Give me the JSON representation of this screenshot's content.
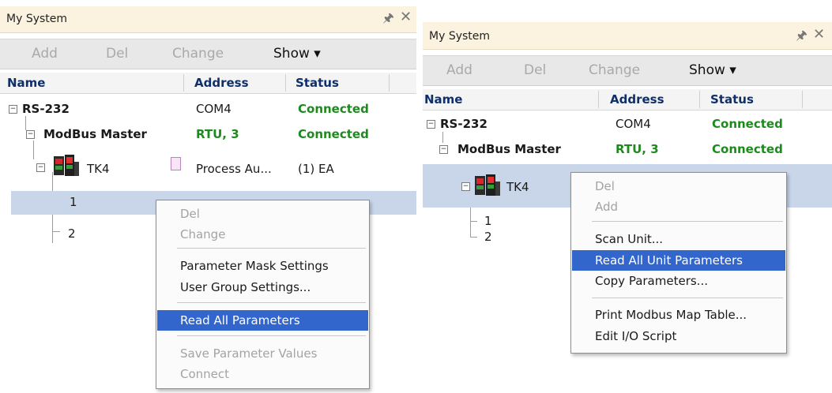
{
  "left": {
    "title": "My System",
    "toolbar": {
      "add": "Add",
      "del": "Del",
      "change": "Change",
      "show": "Show ▾"
    },
    "columns": {
      "name": "Name",
      "address": "Address",
      "status": "Status"
    },
    "rows": [
      {
        "name": "RS-232",
        "address": "COM4",
        "status": "Connected"
      },
      {
        "name": "ModBus Master",
        "address": "RTU, 3",
        "status": "Connected"
      },
      {
        "name": "TK4",
        "address": "Process Au...",
        "status": "(1) EA"
      },
      {
        "name": "1"
      },
      {
        "name": "2"
      }
    ],
    "menu": [
      "Del",
      "Change",
      "Parameter Mask Settings",
      "User Group Settings...",
      "Read All Parameters",
      "Save Parameter Values",
      "Connect"
    ]
  },
  "right": {
    "title": "My System",
    "toolbar": {
      "add": "Add",
      "del": "Del",
      "change": "Change",
      "show": "Show ▾"
    },
    "columns": {
      "name": "Name",
      "address": "Address",
      "status": "Status"
    },
    "rows": [
      {
        "name": "RS-232",
        "address": "COM4",
        "status": "Connected"
      },
      {
        "name": "ModBus Master",
        "address": "RTU, 3",
        "status": "Connected"
      },
      {
        "name": "TK4"
      },
      {
        "name": "1"
      },
      {
        "name": "2"
      }
    ],
    "menu": [
      "Del",
      "Add",
      "Scan Unit...",
      "Read All Unit Parameters",
      "Copy Parameters...",
      "Print Modbus Map Table...",
      "Edit I/O Script"
    ]
  },
  "icons": {
    "pin": "pin-icon",
    "close": "close-icon",
    "device": "controller-device-icon",
    "params": "parameter-sheet-icon"
  },
  "colors": {
    "connected": "#1e8a1e",
    "header": "#0f2f6b",
    "selection": "#3366cc",
    "row_highlight": "#c9d6ea",
    "titlebar": "#fbf3df"
  }
}
